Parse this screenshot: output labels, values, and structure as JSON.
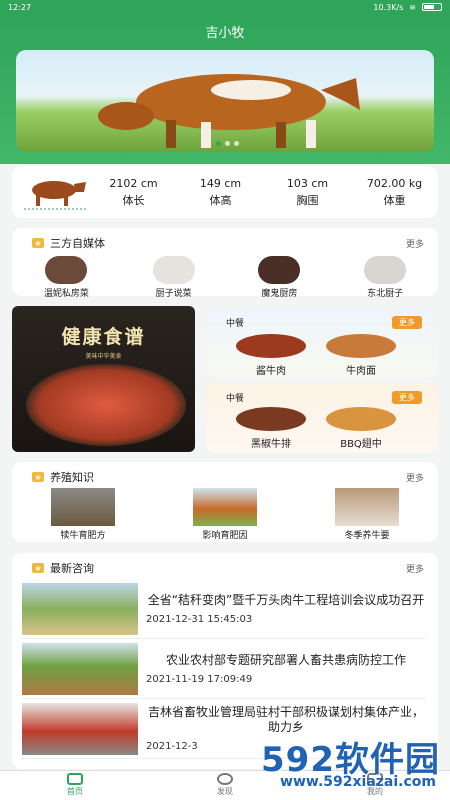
{
  "status_bar": {
    "time": "12:27",
    "speed": "10.3K/s",
    "battery": ""
  },
  "app": {
    "title": "吉小牧"
  },
  "colors": {
    "primary": "#2fa55a",
    "accent": "#f09a2a"
  },
  "stats": [
    {
      "value": "2102 cm",
      "label": "体长"
    },
    {
      "value": "149 cm",
      "label": "体高"
    },
    {
      "value": "103 cm",
      "label": "胸围"
    },
    {
      "value": "702.00 kg",
      "label": "体重"
    }
  ],
  "media": {
    "title": "三方自媒体",
    "more": "更多",
    "items": [
      {
        "label": "温妮私房菜"
      },
      {
        "label": "厨子说菜"
      },
      {
        "label": "魔鬼厨房"
      },
      {
        "label": "东北厨子"
      }
    ]
  },
  "recipe_poster": {
    "title": "健康食谱",
    "subtitle": "美味中华美食"
  },
  "meals": [
    {
      "tag": "中餐",
      "more": "更多",
      "dishes": [
        "酱牛肉",
        "牛肉面"
      ]
    },
    {
      "tag": "中餐",
      "more": "更多",
      "dishes": [
        "黑椒牛排",
        "BBQ翅中"
      ]
    }
  ],
  "breeding": {
    "title": "养殖知识",
    "more": "更多",
    "items": [
      {
        "label": "犊牛育肥方"
      },
      {
        "label": "影响育肥因"
      },
      {
        "label": "冬季养牛要"
      }
    ]
  },
  "news": {
    "title": "最新咨询",
    "more": "更多",
    "items": [
      {
        "title": "全省“秸秆变肉”暨千万头肉牛工程培训会议成功召开",
        "date": "2021-12-31 15:45:03"
      },
      {
        "title": "农业农村部专题研究部署人畜共患病防控工作",
        "date": "2021-11-19 17:09:49"
      },
      {
        "title": "吉林省畜牧业管理局驻村干部积极谋划村集体产业，助力乡",
        "date": "2021-12-3"
      }
    ]
  },
  "tabs": [
    {
      "label": "首页",
      "icon": "home-icon"
    },
    {
      "label": "发现",
      "icon": "discover-icon"
    },
    {
      "label": "我的",
      "icon": "profile-icon"
    }
  ],
  "watermark": {
    "main": "592软件园",
    "url": "www.592xiazai.com"
  }
}
